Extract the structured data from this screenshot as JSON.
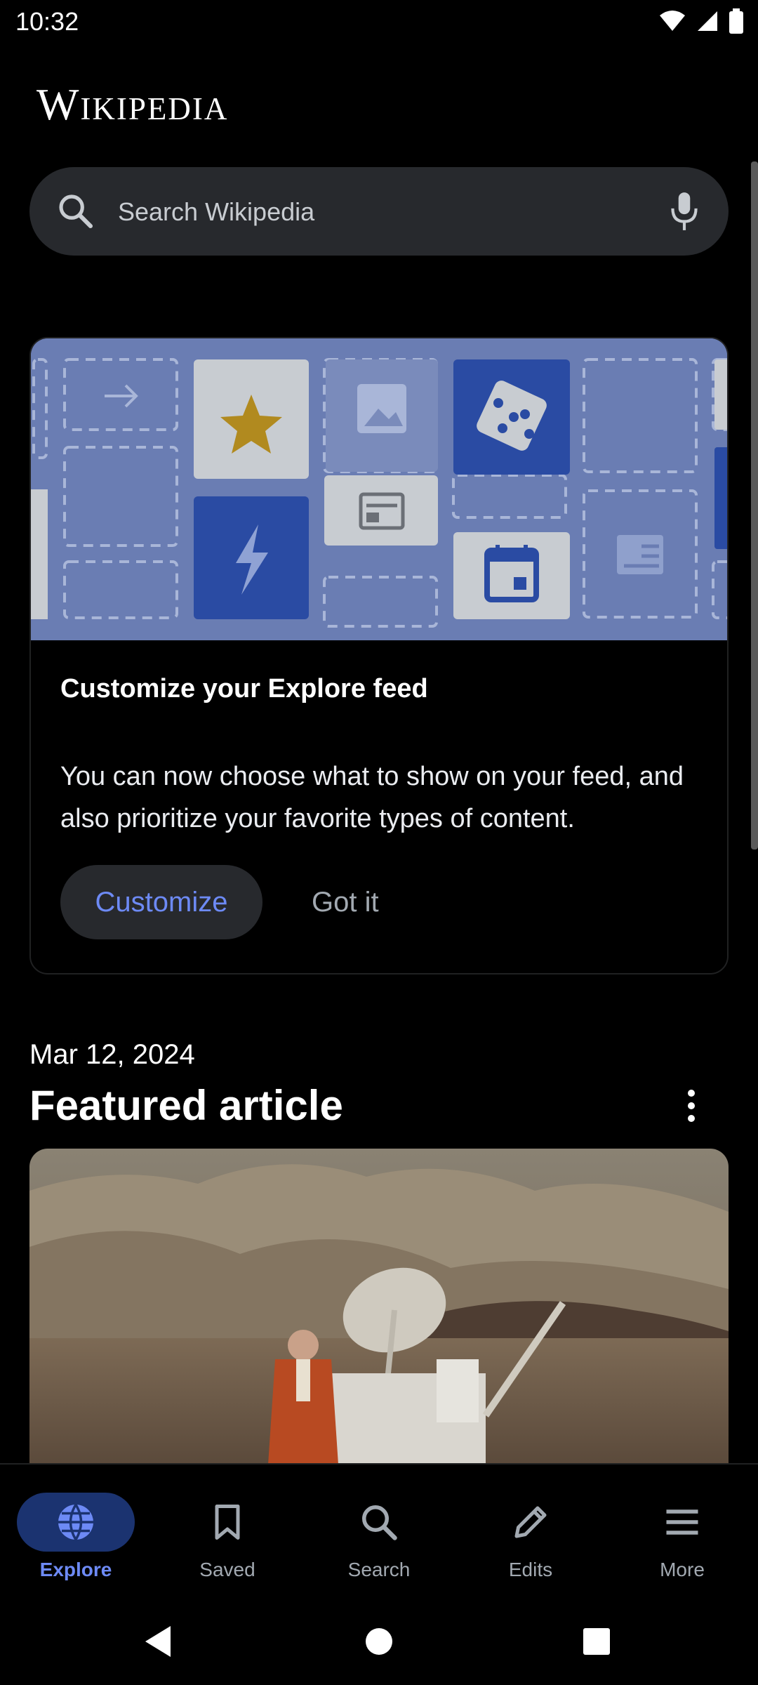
{
  "status_bar": {
    "time": "10:32"
  },
  "header": {
    "logo": "Wikipedia"
  },
  "search": {
    "placeholder": "Search Wikipedia"
  },
  "customize_card": {
    "title": "Customize your Explore feed",
    "body": "You can now choose what to show on your feed, and also prioritize your favorite types of content.",
    "primary_button": "Customize",
    "secondary_button": "Got it"
  },
  "featured": {
    "date": "Mar 12, 2024",
    "title": "Featured article"
  },
  "bottom_nav": {
    "items": [
      {
        "label": "Explore",
        "icon": "globe-icon",
        "active": true
      },
      {
        "label": "Saved",
        "icon": "bookmark-icon",
        "active": false
      },
      {
        "label": "Search",
        "icon": "search-icon",
        "active": false
      },
      {
        "label": "Edits",
        "icon": "pencil-icon",
        "active": false
      },
      {
        "label": "More",
        "icon": "menu-icon",
        "active": false
      }
    ]
  },
  "colors": {
    "accent": "#6d8af5",
    "active_pill": "#1b3370",
    "surface": "#27292d",
    "illustration_bg": "#6a7db3"
  }
}
